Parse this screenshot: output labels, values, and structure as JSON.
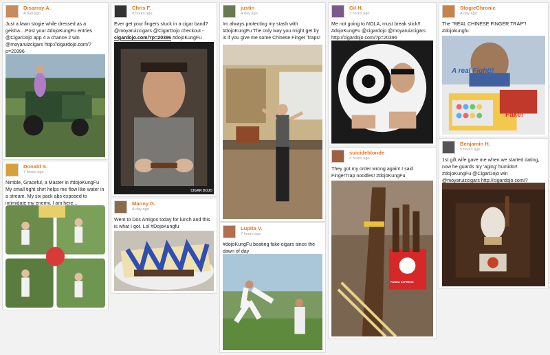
{
  "posts": [
    {
      "user": "Disarray A.",
      "time": "A day ago",
      "text": "Just a lawn stogie while dressed as a geisha....Post your #dojoKungFu entries @CigarDojo app 4 a chance 2 win @moyaruizcigars http://cigardojo.com/?p=20396",
      "avatar_color": "#c88a5e"
    },
    {
      "user": "Donald S.",
      "time": "7 hours ago",
      "text": "Nimble, Graceful, a Master in #dojoKungFu My small tight shirt helps me flow like water in a stream. My six pack abs exposed to intimidate my enemy. I am here...",
      "avatar_color": "#d9a03a"
    },
    {
      "user": "Chris F.",
      "time": "8 hours ago",
      "text_before": "Ever get your fingers stuck in a cigar band? @moyaruizcigars @CigarDojo checkout - ",
      "text_link": "cigardojo.com/?p=20396",
      "text_after": " #dojoKungFu",
      "photo_label": "CIGAR DOJO",
      "avatar_color": "#333333"
    },
    {
      "user": "Manny G.",
      "time": "A day ago",
      "text": "Went to Dos Amigos today for lunch and this is what I got. Lol #DojoKungfu",
      "avatar_color": "#8a6a4a"
    },
    {
      "user": "justin",
      "time": "A day ago",
      "text": "Im always protecting my stash with #dojoKungFu The only way you might get by is if you give me some Chinese Finger Traps!",
      "avatar_color": "#6a7a50"
    },
    {
      "user": "Lupita V.",
      "time": "7 hours ago",
      "text": "#dojoKungFu beating fake cigars since the dawn of day",
      "avatar_color": "#b07050"
    },
    {
      "user": "Gil H.",
      "time": "3 hours ago",
      "text": "Me not going to NOLA, must break stick!! #dojoKungFu @cigardojo @moyaruizcigars http://cigardojo.com/?p=20396",
      "avatar_color": "#7a5a8a"
    },
    {
      "user": "suicideblonde",
      "time": "3 hours ago",
      "text": "They got my order wrong again! I said FingerTrap noodles! #dojoKungFu",
      "panda_label": "PANDA EXPRESS",
      "avatar_color": "#a06040"
    },
    {
      "user": "StogieChronic",
      "time": "A day ago",
      "text": "The \"REAL CHINESE FINGER TRAP\"! #dojokungfu",
      "photo_text_1": "A real Fight!!",
      "photo_text_2": "Fake!",
      "avatar_color": "#c8824a"
    },
    {
      "user": "Benjamin H.",
      "time": "5 hours ago",
      "text": "1st gift wife gave me when we started dating, now he guards my 'aging' humidor! #dojoKungFu @CigarDojo win @moyaruizcigars http://cigardojo.com/?p=20396",
      "avatar_color": "#555555"
    }
  ],
  "accent_color": "#e8741f"
}
